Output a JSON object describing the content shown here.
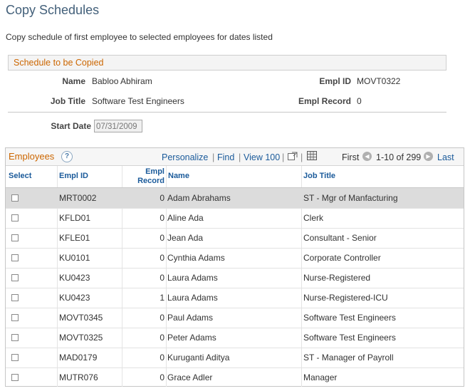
{
  "page": {
    "title": "Copy Schedules",
    "instruction": "Copy schedule of first employee to selected employees for dates listed"
  },
  "schedule": {
    "section_title": "Schedule to be Copied",
    "name_label": "Name",
    "name_value": "Babloo Abhiram",
    "empl_id_label": "Empl ID",
    "empl_id_value": "MOVT0322",
    "job_title_label": "Job Title",
    "job_title_value": "Software Test Engineers",
    "empl_record_label": "Empl Record",
    "empl_record_value": "0",
    "start_date_label": "Start Date",
    "start_date_value": "07/31/2009"
  },
  "grid": {
    "title": "Employees",
    "personalize": "Personalize",
    "find": "Find",
    "view": "View 100",
    "first": "First",
    "range": "1-10 of 299",
    "last": "Last",
    "columns": {
      "select": "Select",
      "empl_id": "Empl ID",
      "empl_record_1": "Empl",
      "empl_record_2": "Record",
      "name": "Name",
      "job_title": "Job Title"
    },
    "rows": [
      {
        "empl_id": "MRT0002",
        "record": "0",
        "name": "Adam Abrahams",
        "job": "ST - Mgr of Manfacturing"
      },
      {
        "empl_id": "KFLD01",
        "record": "0",
        "name": "Aline Ada",
        "job": "Clerk"
      },
      {
        "empl_id": "KFLE01",
        "record": "0",
        "name": "Jean Ada",
        "job": "Consultant - Senior"
      },
      {
        "empl_id": "KU0101",
        "record": "0",
        "name": "Cynthia Adams",
        "job": "Corporate Controller"
      },
      {
        "empl_id": "KU0423",
        "record": "0",
        "name": "Laura Adams",
        "job": "Nurse-Registered"
      },
      {
        "empl_id": "KU0423",
        "record": "1",
        "name": "Laura Adams",
        "job": "Nurse-Registered-ICU"
      },
      {
        "empl_id": "MOVT0345",
        "record": "0",
        "name": "Paul Adams",
        "job": "Software Test Engineers"
      },
      {
        "empl_id": "MOVT0325",
        "record": "0",
        "name": "Peter Adams",
        "job": "Software Test Engineers"
      },
      {
        "empl_id": "MAD0179",
        "record": "0",
        "name": "Kuruganti Aditya",
        "job": "ST - Manager of Payroll"
      },
      {
        "empl_id": "MUTR076",
        "record": "0",
        "name": "Grace Adler",
        "job": "Manager"
      }
    ]
  },
  "colors": {
    "title": "#43607a",
    "section_orange": "#cc6600",
    "link_blue": "#1a5a9a",
    "selected_row": "#dcdcdc"
  },
  "icons": {
    "help": "help-icon",
    "zoom": "zoom-grid-icon",
    "download": "download-icon",
    "prev": "previous-arrow-icon",
    "next": "next-arrow-icon"
  }
}
